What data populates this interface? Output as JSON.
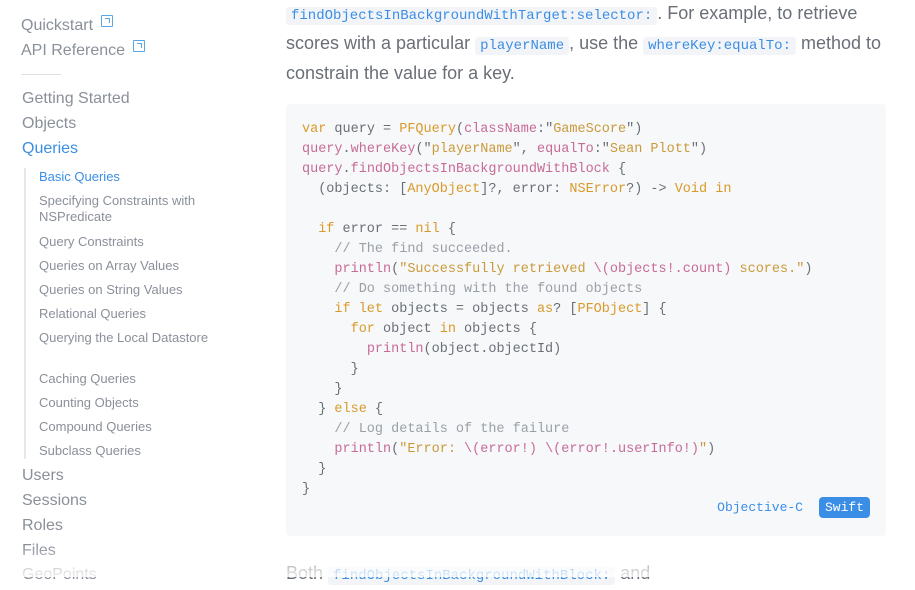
{
  "sidebar": {
    "external_links": [
      {
        "label": "Quickstart"
      },
      {
        "label": "API Reference"
      }
    ],
    "sections": [
      {
        "label": "Getting Started"
      },
      {
        "label": "Objects"
      },
      {
        "label": "Queries"
      },
      {
        "label": "Users"
      },
      {
        "label": "Sessions"
      },
      {
        "label": "Roles"
      },
      {
        "label": "Files"
      },
      {
        "label": "GeoPoints"
      }
    ],
    "query_subitems": [
      {
        "label": "Basic Queries"
      },
      {
        "label": "Specifying Constraints with NSPredicate"
      },
      {
        "label": "Query Constraints"
      },
      {
        "label": "Queries on Array Values"
      },
      {
        "label": "Queries on String Values"
      },
      {
        "label": "Relational Queries"
      },
      {
        "label": "Querying the Local Datastore"
      },
      {
        "label": "Caching Queries"
      },
      {
        "label": "Counting Objects"
      },
      {
        "label": "Compound Queries"
      },
      {
        "label": "Subclass Queries"
      }
    ]
  },
  "intro": {
    "code_selector": "findObjectsInBackgroundWithTarget:selector:",
    "text_1": ". For example, to retrieve scores with a particular ",
    "code_player": "playerName",
    "text_2": ", use the ",
    "code_where": "whereKey:equalTo:",
    "text_3": " method to constrain the value for a key."
  },
  "code": {
    "lines": {
      "l1_kw": "var",
      "l1_rest": " query = ",
      "l1_type": "PFQuery",
      "l1_arg": "className",
      "l1_str": "GameScore",
      "l2_obj": "query",
      "l2_fn": "whereKey",
      "l2_str1": "playerName",
      "l2_arg": "equalTo",
      "l2_str2": "Sean Plott",
      "l3_obj": "query",
      "l3_fn": "findObjectsInBackgroundWithBlock",
      "l4_type1": "AnyObject",
      "l4_type2": "NSError",
      "l4_kw": "Void",
      "l4_in": "in",
      "c1": "// The find succeeded.",
      "s1": "\"Successfully retrieved ",
      "s1_interp": "\\(objects!.count)",
      "s1_end": " scores.\"",
      "c2": "// Do something with the found objects",
      "c3": "// Log details of the failure",
      "s2": "\"Error: ",
      "s2_interp1": "\\(error!)",
      "s2_interp2": "\\(error!.userInfo!)",
      "fn_println": "println",
      "type_pfobject": "PFObject"
    },
    "languages": [
      {
        "label": "Objective-C",
        "selected": false
      },
      {
        "label": "Swift",
        "selected": true
      }
    ]
  },
  "outro": {
    "text_1": "Both ",
    "code_block": "findObjectsInBackgroundWithBlock:",
    "text_2": " and"
  },
  "colors": {
    "accent": "#3a8ee6",
    "code_bg": "#f7f8f9"
  }
}
